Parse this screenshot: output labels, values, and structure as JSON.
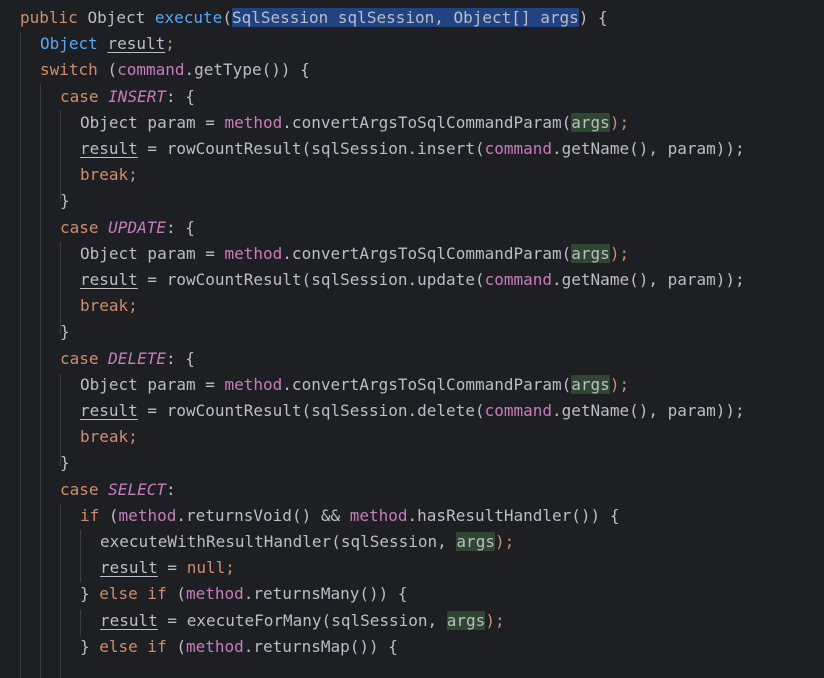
{
  "editor": {
    "lines": [
      {
        "indent": 0,
        "tokens": [
          {
            "t": "public ",
            "c": "kw"
          },
          {
            "t": "Object ",
            "c": "plain"
          },
          {
            "t": "execute",
            "c": "fn"
          },
          {
            "t": "(",
            "c": "plain"
          },
          {
            "t": "SqlSession sqlSession, Object[] args",
            "c": "plain sel"
          },
          {
            "t": ") {",
            "c": "plain"
          }
        ]
      },
      {
        "indent": 1,
        "tokens": [
          {
            "t": "Object ",
            "c": "type-blue"
          },
          {
            "t": "result",
            "c": "plain ul"
          },
          {
            "t": ";",
            "c": "kw"
          }
        ]
      },
      {
        "indent": 1,
        "tokens": [
          {
            "t": "switch ",
            "c": "kw"
          },
          {
            "t": "(",
            "c": "plain"
          },
          {
            "t": "command",
            "c": "field"
          },
          {
            "t": ".getType()) {",
            "c": "plain"
          }
        ]
      },
      {
        "indent": 2,
        "tokens": [
          {
            "t": "case ",
            "c": "kw"
          },
          {
            "t": "INSERT",
            "c": "const"
          },
          {
            "t": ": {",
            "c": "plain"
          }
        ]
      },
      {
        "indent": 3,
        "tokens": [
          {
            "t": "Object param = ",
            "c": "plain"
          },
          {
            "t": "method",
            "c": "field"
          },
          {
            "t": ".convertArgsToSqlCommandParam(",
            "c": "plain"
          },
          {
            "t": "args",
            "c": "plain hl"
          },
          {
            "t": ");",
            "c": "kw"
          }
        ]
      },
      {
        "indent": 3,
        "tokens": [
          {
            "t": "result",
            "c": "plain ul"
          },
          {
            "t": " = rowCountResult(sqlSession.insert(",
            "c": "plain"
          },
          {
            "t": "command",
            "c": "field"
          },
          {
            "t": ".getName(), param));",
            "c": "plain"
          }
        ]
      },
      {
        "indent": 3,
        "tokens": [
          {
            "t": "break;",
            "c": "kw"
          }
        ]
      },
      {
        "indent": 2,
        "tokens": [
          {
            "t": "}",
            "c": "plain"
          }
        ]
      },
      {
        "indent": 2,
        "tokens": [
          {
            "t": "case ",
            "c": "kw"
          },
          {
            "t": "UPDATE",
            "c": "const"
          },
          {
            "t": ": {",
            "c": "plain"
          }
        ]
      },
      {
        "indent": 3,
        "tokens": [
          {
            "t": "Object param = ",
            "c": "plain"
          },
          {
            "t": "method",
            "c": "field"
          },
          {
            "t": ".convertArgsToSqlCommandParam(",
            "c": "plain"
          },
          {
            "t": "args",
            "c": "plain hl"
          },
          {
            "t": ");",
            "c": "kw"
          }
        ]
      },
      {
        "indent": 3,
        "tokens": [
          {
            "t": "result",
            "c": "plain ul"
          },
          {
            "t": " = rowCountResult(sqlSession.update(",
            "c": "plain"
          },
          {
            "t": "command",
            "c": "field"
          },
          {
            "t": ".getName(), param));",
            "c": "plain"
          }
        ]
      },
      {
        "indent": 3,
        "tokens": [
          {
            "t": "break;",
            "c": "kw"
          }
        ]
      },
      {
        "indent": 2,
        "tokens": [
          {
            "t": "}",
            "c": "plain"
          }
        ]
      },
      {
        "indent": 2,
        "tokens": [
          {
            "t": "case ",
            "c": "kw"
          },
          {
            "t": "DELETE",
            "c": "const"
          },
          {
            "t": ": {",
            "c": "plain"
          }
        ]
      },
      {
        "indent": 3,
        "tokens": [
          {
            "t": "Object param = ",
            "c": "plain"
          },
          {
            "t": "method",
            "c": "field"
          },
          {
            "t": ".convertArgsToSqlCommandParam(",
            "c": "plain"
          },
          {
            "t": "args",
            "c": "plain hl"
          },
          {
            "t": ");",
            "c": "kw"
          }
        ]
      },
      {
        "indent": 3,
        "tokens": [
          {
            "t": "result",
            "c": "plain ul"
          },
          {
            "t": " = rowCountResult(sqlSession.delete(",
            "c": "plain"
          },
          {
            "t": "command",
            "c": "field"
          },
          {
            "t": ".getName(), param));",
            "c": "plain"
          }
        ]
      },
      {
        "indent": 3,
        "tokens": [
          {
            "t": "break;",
            "c": "kw"
          }
        ]
      },
      {
        "indent": 2,
        "tokens": [
          {
            "t": "}",
            "c": "plain"
          }
        ]
      },
      {
        "indent": 2,
        "tokens": [
          {
            "t": "case ",
            "c": "kw"
          },
          {
            "t": "SELECT",
            "c": "const"
          },
          {
            "t": ":",
            "c": "plain"
          }
        ]
      },
      {
        "indent": 3,
        "tokens": [
          {
            "t": "if ",
            "c": "kw"
          },
          {
            "t": "(",
            "c": "plain"
          },
          {
            "t": "method",
            "c": "field"
          },
          {
            "t": ".returnsVoid() && ",
            "c": "plain"
          },
          {
            "t": "method",
            "c": "field"
          },
          {
            "t": ".hasResultHandler()) {",
            "c": "plain"
          }
        ]
      },
      {
        "indent": 4,
        "tokens": [
          {
            "t": "executeWithResultHandler(sqlSession, ",
            "c": "plain"
          },
          {
            "t": "args",
            "c": "plain hl"
          },
          {
            "t": ");",
            "c": "kw"
          }
        ]
      },
      {
        "indent": 4,
        "tokens": [
          {
            "t": "result",
            "c": "plain ul"
          },
          {
            "t": " = ",
            "c": "plain"
          },
          {
            "t": "null;",
            "c": "kw"
          }
        ]
      },
      {
        "indent": 3,
        "tokens": [
          {
            "t": "} ",
            "c": "plain"
          },
          {
            "t": "else if ",
            "c": "kw"
          },
          {
            "t": "(",
            "c": "plain"
          },
          {
            "t": "method",
            "c": "field"
          },
          {
            "t": ".returnsMany()) {",
            "c": "plain"
          }
        ]
      },
      {
        "indent": 4,
        "tokens": [
          {
            "t": "result",
            "c": "plain ul"
          },
          {
            "t": " = executeForMany(sqlSession, ",
            "c": "plain"
          },
          {
            "t": "args",
            "c": "plain hl"
          },
          {
            "t": ");",
            "c": "kw"
          }
        ]
      },
      {
        "indent": 3,
        "tokens": [
          {
            "t": "} ",
            "c": "plain"
          },
          {
            "t": "else if ",
            "c": "kw"
          },
          {
            "t": "(",
            "c": "plain"
          },
          {
            "t": "method",
            "c": "field"
          },
          {
            "t": ".returnsMap()) {",
            "c": "plain"
          }
        ]
      }
    ]
  }
}
